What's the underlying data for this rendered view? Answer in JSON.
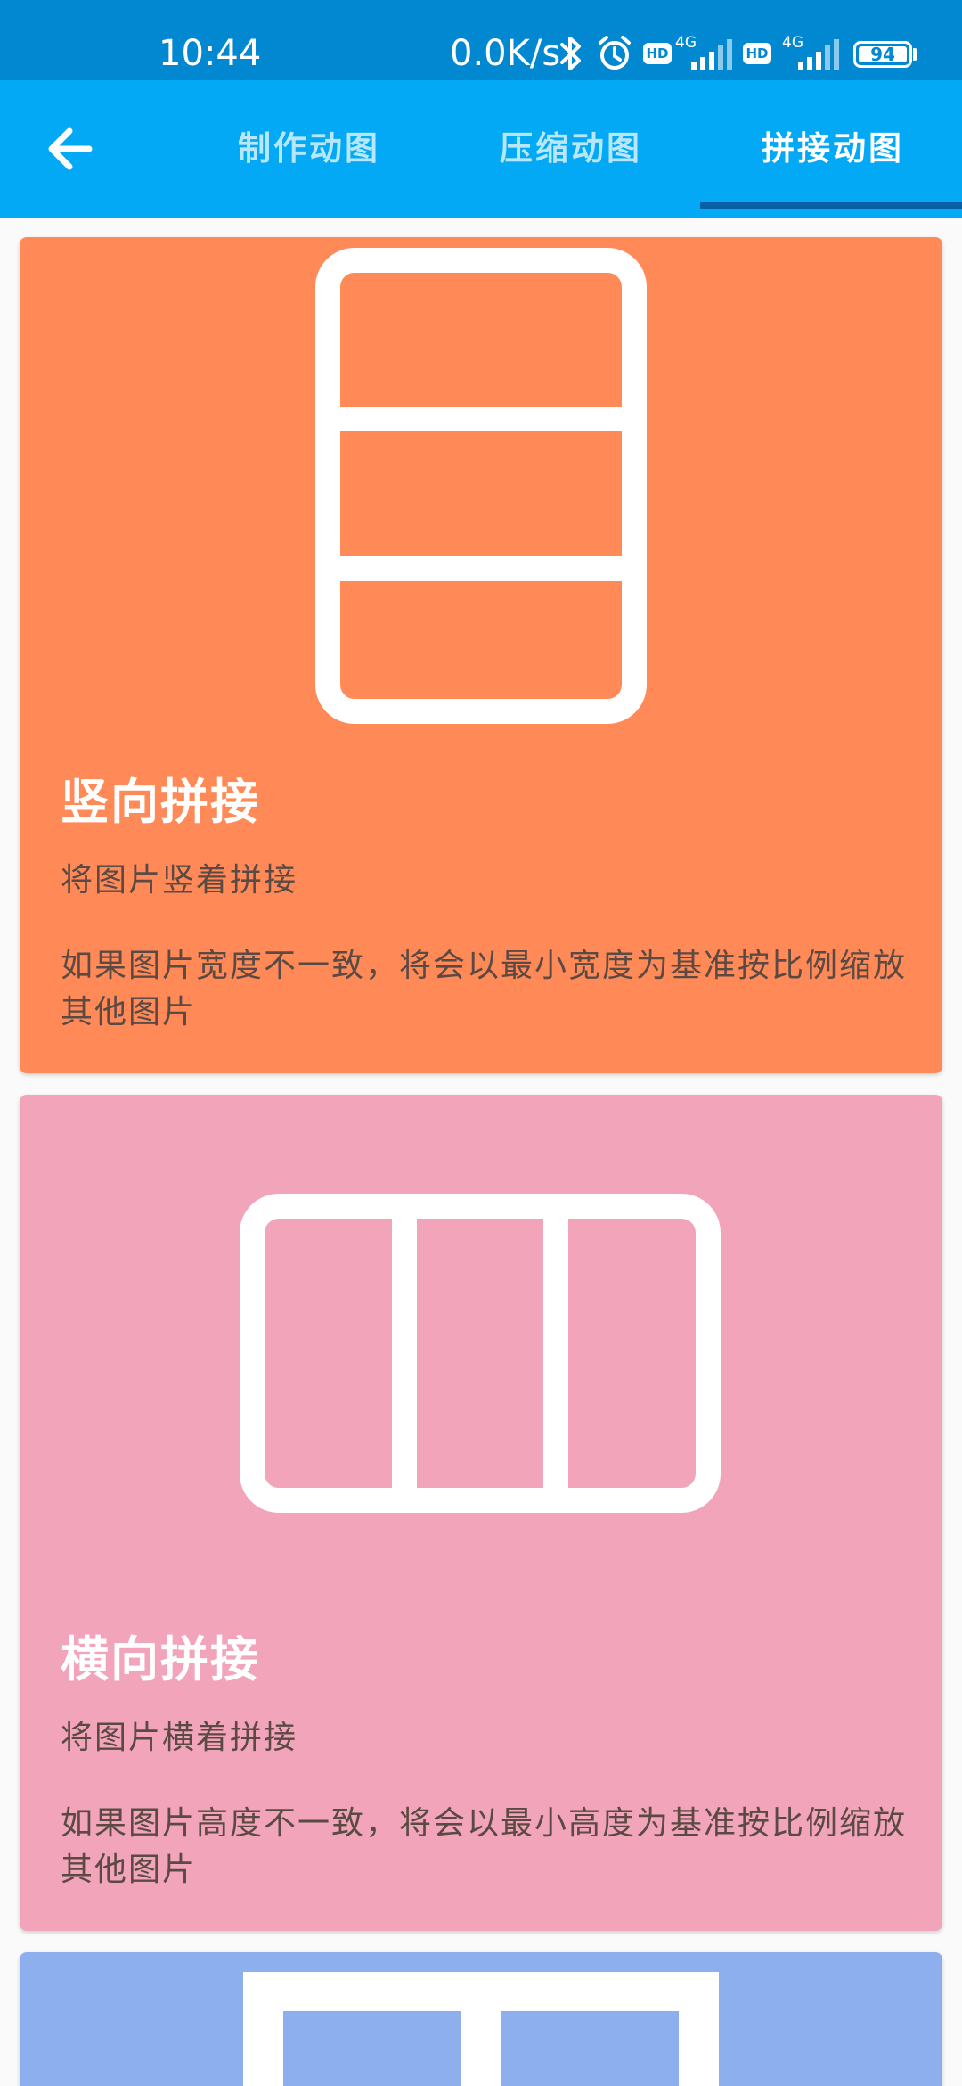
{
  "status_bar": {
    "time": "10:44",
    "net_speed": "0.0K/s",
    "hd_badge": "HD",
    "network": "4G",
    "battery": "94",
    "icons": [
      "bluetooth-icon",
      "alarm-icon",
      "signal-icon",
      "signal-icon"
    ]
  },
  "app_bar": {
    "back_icon": "arrow-left-icon",
    "tabs": [
      {
        "label": "制作动图"
      },
      {
        "label": "压缩动图"
      },
      {
        "label": "拼接动图"
      }
    ],
    "active_tab": 2
  },
  "cards": [
    {
      "title": "竖向拼接",
      "subtitle": "将图片竖着拼接",
      "description": "如果图片宽度不一致，将会以最小宽度为基准按比例缩放其他图片",
      "color": "#FF8A58",
      "icon": "vertical-stitch-icon"
    },
    {
      "title": "横向拼接",
      "subtitle": "将图片横着拼接",
      "description": "如果图片高度不一致，将会以最小高度为基准按比例缩放其他图片",
      "color": "#F2A4BB",
      "icon": "horizontal-stitch-icon"
    },
    {
      "title": "",
      "subtitle": "",
      "description": "",
      "color": "#8EAFEE",
      "icon": "grid-stitch-icon"
    }
  ],
  "colors": {
    "status_bar": "#0288D1",
    "app_bar": "#03A9F4",
    "tab_indicator": "#0A5EA8",
    "card_text": "#5B4A43"
  }
}
